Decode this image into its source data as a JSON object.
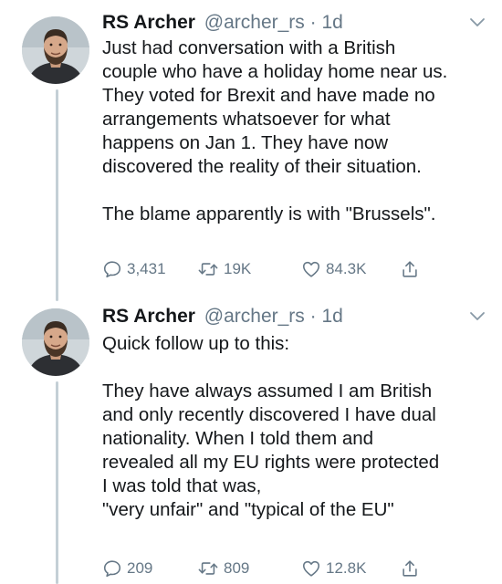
{
  "colors": {
    "text": "#14171a",
    "secondary": "#657786",
    "thread_line": "#c4cfd6"
  },
  "tweets": [
    {
      "author": {
        "display_name": "RS Archer",
        "handle": "@archer_rs",
        "separator": "·",
        "time": "1d",
        "avatar_icon": "bearded-man-avatar"
      },
      "paragraphs": [
        "Just had conversation with a British\ncouple who have a holiday home near us.\nThey voted for Brexit and have made no\narrangements whatsoever for what\nhappens on Jan 1.  They have now\ndiscovered the reality of their situation.",
        "The blame apparently is with \"Brussels\"."
      ],
      "actions": {
        "replies": "3,431",
        "retweets": "19K",
        "likes": "84.3K"
      },
      "icons": [
        "reply-icon",
        "retweet-icon",
        "like-icon",
        "share-icon",
        "chevron-down-icon"
      ]
    },
    {
      "author": {
        "display_name": "RS Archer",
        "handle": "@archer_rs",
        "separator": "·",
        "time": "1d",
        "avatar_icon": "bearded-man-avatar"
      },
      "paragraphs": [
        "Quick follow up to this:",
        "They have always assumed I am British\nand only recently discovered I have dual\nnationality.  When I told them and\nrevealed all my EU rights were protected\nI was told that was,\n\"very unfair\" and \"typical of the EU\""
      ],
      "actions": {
        "replies": "209",
        "retweets": "809",
        "likes": "12.8K"
      },
      "icons": [
        "reply-icon",
        "retweet-icon",
        "like-icon",
        "share-icon",
        "chevron-down-icon"
      ]
    }
  ]
}
